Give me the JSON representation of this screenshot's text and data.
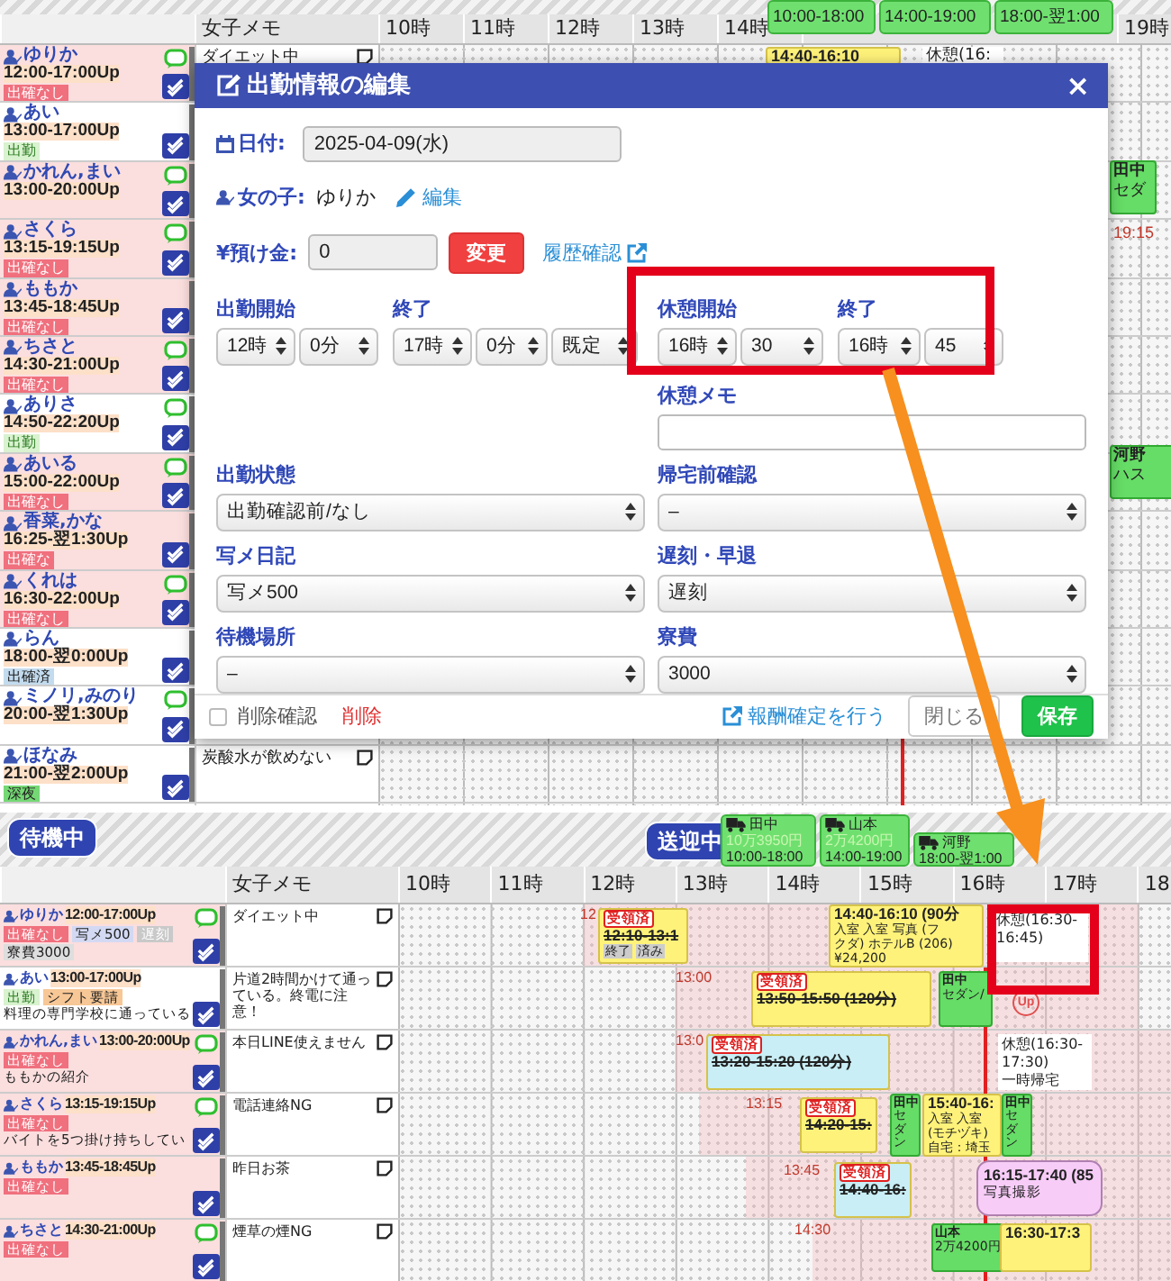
{
  "top": {
    "drivers": [
      {
        "time": "10:00-18:00"
      },
      {
        "time": "14:00-19:00"
      },
      {
        "time": "18:00-翌1:00"
      }
    ],
    "memo_header": "女子メモ",
    "hours": [
      "10時",
      "11時",
      "12時",
      "13時",
      "14時"
    ],
    "hours_right": [
      "19時"
    ],
    "rows": [
      {
        "name": "ゆりか",
        "time": "12:00-17:00Up",
        "chat": true,
        "highlight": true,
        "badges": [
          {
            "text": "出確なし",
            "kind": "unconfirmed"
          }
        ],
        "memo": "ダイエット中"
      },
      {
        "name": "あい",
        "time": "13:00-17:00Up",
        "chat": false,
        "highlight": false,
        "badges": [
          {
            "text": "出勤",
            "kind": "attend"
          }
        ]
      },
      {
        "name": "かれん,まい",
        "time": "13:00-20:00Up",
        "chat": true,
        "highlight": true,
        "badges": []
      },
      {
        "name": "さくら",
        "time": "13:15-19:15Up",
        "chat": true,
        "highlight": true,
        "badges": [
          {
            "text": "出確なし",
            "kind": "unconfirmed"
          }
        ]
      },
      {
        "name": "ももか",
        "time": "13:45-18:45Up",
        "chat": false,
        "highlight": true,
        "badges": [
          {
            "text": "出確なし",
            "kind": "unconfirmed"
          }
        ]
      },
      {
        "name": "ちさと",
        "time": "14:30-21:00Up",
        "chat": true,
        "highlight": true,
        "badges": [
          {
            "text": "出確なし",
            "kind": "unconfirmed"
          }
        ]
      },
      {
        "name": "ありさ",
        "time": "14:50-22:20Up",
        "chat": true,
        "highlight": false,
        "badges": [
          {
            "text": "出勤",
            "kind": "attend"
          }
        ]
      },
      {
        "name": "あいる",
        "time": "15:00-22:00Up",
        "chat": true,
        "highlight": true,
        "badges": [
          {
            "text": "出確なし",
            "kind": "unconfirmed"
          }
        ]
      },
      {
        "name": "香菜,かな",
        "time": "16:25-翌1:30Up",
        "chat": false,
        "highlight": true,
        "badges": [
          {
            "text": "出確な",
            "kind": "unconfirmed"
          }
        ]
      },
      {
        "name": "くれは",
        "time": "16:30-22:00Up",
        "chat": true,
        "highlight": true,
        "badges": [
          {
            "text": "出確なし",
            "kind": "unconfirmed"
          }
        ]
      },
      {
        "name": "らん",
        "time": "18:00-翌0:00Up",
        "chat": false,
        "highlight": false,
        "badges": [
          {
            "text": "出確済",
            "kind": "confirmed"
          }
        ]
      },
      {
        "name": "ミノリ,みのり",
        "time": "20:00-翌1:30Up",
        "chat": true,
        "highlight": false,
        "badges": []
      },
      {
        "name": "ほなみ",
        "time": "21:00-翌2:00Up",
        "chat": false,
        "highlight": false,
        "badges": [
          {
            "text": "深夜",
            "kind": "night"
          }
        ],
        "memo": "炭酸水が飲めない"
      }
    ],
    "items": [
      {
        "kind": "booking",
        "color": "#fff27a",
        "lines": [
          "14:40-16:10"
        ]
      },
      {
        "kind": "break",
        "lines": [
          "休憩(16:"
        ]
      },
      {
        "kind": "driver",
        "lines": [
          "田中",
          "セダ"
        ]
      },
      {
        "kind": "time",
        "lines": [
          "19:15"
        ]
      },
      {
        "kind": "driver",
        "lines": [
          "河野",
          "ハス"
        ]
      }
    ]
  },
  "modal": {
    "title": "出勤情報の編集",
    "close": "×",
    "date": {
      "label": "日付:",
      "value": "2025-04-09(水)"
    },
    "girl": {
      "label": "女の子:",
      "value": "ゆりか",
      "link": "編集"
    },
    "deposit": {
      "label": "¥預け金:",
      "value": "0",
      "button": "変更",
      "link": "履歴確認"
    },
    "work_time": [
      {
        "label": "出勤開始",
        "selects": [
          "12時",
          "0分"
        ]
      },
      {
        "label": "終了",
        "selects": [
          "17時",
          "0分",
          "既定"
        ]
      }
    ],
    "break_time": [
      {
        "label": "休憩開始",
        "selects": [
          "16時",
          "30"
        ]
      },
      {
        "label": "終了",
        "selects": [
          "16時",
          "45"
        ]
      }
    ],
    "break_memo": {
      "label": "休憩メモ"
    },
    "fields": [
      {
        "label": "出勤状態",
        "value": "出勤確認前/なし"
      },
      {
        "label": "帰宅前確認",
        "value": "–"
      },
      {
        "label": "写メ日記",
        "value": "写メ500"
      },
      {
        "label": "遅刻・早退",
        "value": "遅刻"
      },
      {
        "label": "待機場所",
        "value": "–"
      },
      {
        "label": "寮費",
        "value": "3000"
      }
    ],
    "delete_confirm": {
      "label": "削除確認",
      "checked": false
    },
    "delete": "削除",
    "confirm_link": "報酬確定を行う",
    "buttons": [
      {
        "label": "閉じる",
        "kind": "secondary"
      },
      {
        "label": "保存",
        "kind": "primary"
      }
    ]
  },
  "bottom": {
    "waiting": "待機中",
    "driving": "送迎中",
    "drivers": [
      {
        "lines": [
          "田中",
          "10万3950円",
          "10:00-18:00"
        ]
      },
      {
        "lines": [
          "山本",
          "2万4200円",
          "14:00-19:00"
        ]
      },
      {
        "lines": [
          "河野",
          "18:00-翌1:00"
        ]
      }
    ],
    "memo_header": "女子メモ",
    "hours": [
      "10時",
      "11時",
      "12時",
      "13時",
      "14時",
      "15時",
      "16時",
      "17時",
      "18"
    ],
    "rows": [
      {
        "name": "ゆりか",
        "time": "12:00-17:00Up",
        "chat": true,
        "highlight": true,
        "badges": [
          {
            "text": "出確なし",
            "kind": "unconfirmed"
          },
          {
            "text": "写メ500",
            "kind": "photo"
          },
          {
            "text": "遅刻",
            "kind": "late"
          },
          {
            "text": "寮費3000",
            "kind": "fee"
          }
        ],
        "memo": "ダイエット中"
      },
      {
        "name": "あい",
        "time": "13:00-17:00Up",
        "chat": false,
        "highlight": false,
        "badges": [
          {
            "text": "出勤",
            "kind": "attend"
          },
          {
            "text": "シフト要請",
            "kind": "shift"
          }
        ],
        "note": "料理の専門学校に通っている",
        "memo": "片道2時間かけて通っている。終電に注意！"
      },
      {
        "name": "かれん,まい",
        "time": "13:00-20:00Up",
        "chat": true,
        "highlight": true,
        "badges": [
          {
            "text": "出確なし",
            "kind": "unconfirmed"
          }
        ],
        "note": "ももかの紹介",
        "memo": "本日LINE使えません"
      },
      {
        "name": "さくら",
        "time": "13:15-19:15Up",
        "chat": true,
        "highlight": true,
        "badges": [
          {
            "text": "出確なし",
            "kind": "unconfirmed"
          }
        ],
        "note": "バイトを5つ掛け持ちしてい",
        "memo": "電話連絡NG"
      },
      {
        "name": "ももか",
        "time": "13:45-18:45Up",
        "chat": false,
        "highlight": true,
        "badges": [
          {
            "text": "出確なし",
            "kind": "unconfirmed"
          }
        ],
        "memo": "昨日お茶"
      },
      {
        "name": "ちさと",
        "time": "14:30-21:00Up",
        "chat": true,
        "highlight": true,
        "badges": [
          {
            "text": "出確なし",
            "kind": "unconfirmed"
          }
        ],
        "memo": "煙草の煙NG"
      }
    ],
    "items": [
      {
        "kind": "time",
        "lines": [
          "12"
        ]
      },
      {
        "kind": "booking",
        "color": "#fff27a",
        "tag": "受領済",
        "done": true,
        "lines": [
          "12:10-13:1"
        ],
        "chips": [
          "終了",
          "済み"
        ]
      },
      {
        "kind": "booking",
        "color": "#fff27a",
        "done": false,
        "lines": [
          "14:40-16:10 (90分",
          "入室 入室 写真 (フ",
          "クダ) ホテルB (206)",
          "¥24,200"
        ]
      },
      {
        "kind": "break",
        "lines": [
          "休憩(16:30-16:45)"
        ]
      },
      {
        "kind": "time",
        "lines": [
          "13:00"
        ]
      },
      {
        "kind": "booking",
        "color": "#fff27a",
        "tag": "受領済",
        "done": true,
        "lines": [
          "13:50-15:50 (120分)"
        ]
      },
      {
        "kind": "driver",
        "lines": [
          "田中",
          "セダン/"
        ]
      },
      {
        "kind": "mark",
        "lines": [
          "Up"
        ]
      },
      {
        "kind": "time",
        "lines": [
          "13:0"
        ]
      },
      {
        "kind": "booking",
        "color": "#c9eef5",
        "tag": "受領済",
        "done": true,
        "lines": [
          "13:20-15:20 (120分)"
        ]
      },
      {
        "kind": "break",
        "lines": [
          "休憩(16:30-17:30)",
          "一時帰宅"
        ]
      },
      {
        "kind": "time",
        "lines": [
          "13:15"
        ]
      },
      {
        "kind": "booking",
        "color": "#fff27a",
        "tag": "受領済",
        "done": true,
        "lines": [
          "14:20-15:"
        ]
      },
      {
        "kind": "vdriver",
        "lines": [
          "田中",
          "セダン"
        ]
      },
      {
        "kind": "booking",
        "color": "#fff27a",
        "done": false,
        "lines": [
          "15:40-16:",
          "入室 入室",
          "(モチヅキ)",
          "自宅：埼玉"
        ]
      },
      {
        "kind": "vdriver",
        "lines": [
          "田中",
          "セダン"
        ]
      },
      {
        "kind": "time",
        "lines": [
          "13:45"
        ]
      },
      {
        "kind": "booking",
        "color": "#c9eef5",
        "tag": "受領済",
        "done": true,
        "lines": [
          "14:40-16:"
        ]
      },
      {
        "kind": "event",
        "lines": [
          "16:15-17:40 (85",
          "写真撮影"
        ]
      },
      {
        "kind": "time",
        "lines": [
          "14:30"
        ]
      },
      {
        "kind": "driver",
        "lines": [
          "山本",
          "2万4200円"
        ]
      },
      {
        "kind": "booking",
        "color": "#fff27a",
        "done": false,
        "lines": [
          "16:30-17:3"
        ]
      }
    ]
  },
  "annotations": [
    {
      "kind": "frame"
    },
    {
      "kind": "frame"
    },
    {
      "kind": "arrow"
    }
  ]
}
